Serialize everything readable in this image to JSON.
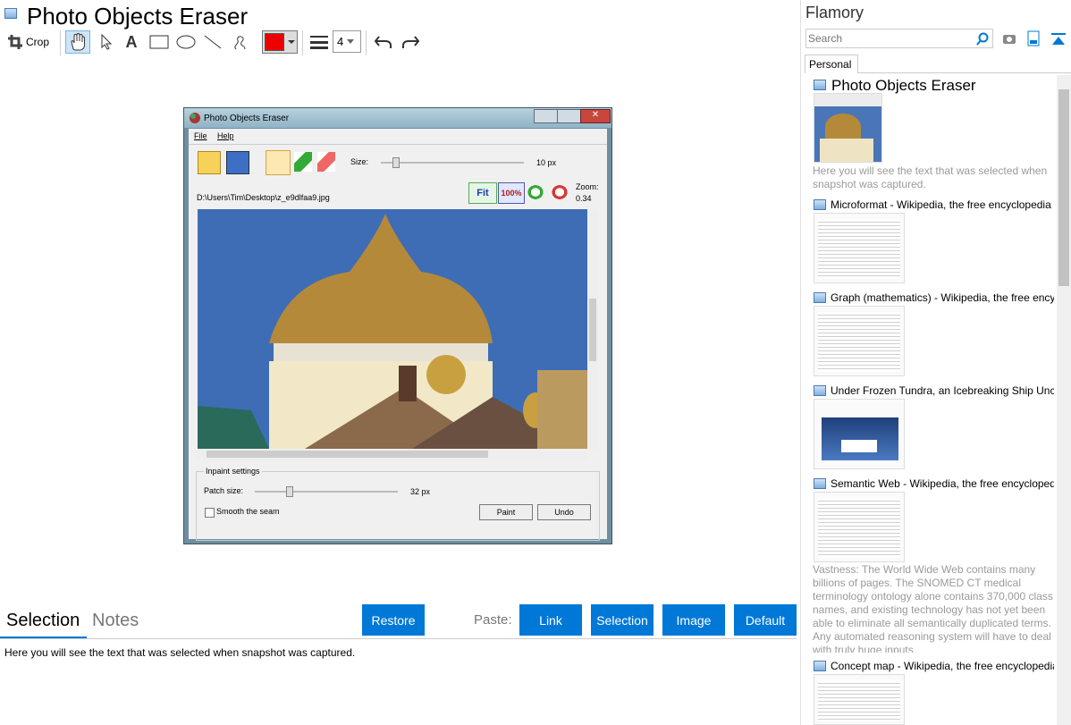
{
  "app": {
    "title": "Photo Objects Eraser"
  },
  "toolbar": {
    "crop_label": "Crop",
    "text_tool": "A",
    "line_width": "4",
    "color": "#ee0000"
  },
  "screenshot": {
    "window_title": "Photo Objects Eraser",
    "menu": [
      "File",
      "Help"
    ],
    "size_label": "Size:",
    "size_value": "10 px",
    "file_path": "D:\\Users\\Tim\\Desktop\\z_e9dlfaa9.jpg",
    "zoom_fit": "Fit",
    "zoom_100": "100%",
    "zoom_label": "Zoom:",
    "zoom_value": "0.34",
    "inpaint_group": "Inpaint settings",
    "patch_label": "Patch size:",
    "patch_value": "32 px",
    "smooth_label": "Smooth the seam",
    "paint_btn": "Paint",
    "undo_btn": "Undo"
  },
  "bottom": {
    "tabs": [
      "Selection",
      "Notes"
    ],
    "restore": "Restore",
    "paste_label": "Paste:",
    "paste_buttons": [
      "Link",
      "Selection",
      "Image",
      "Default"
    ],
    "selection_text": "Here you will see the text that was selected when snapshot was captured."
  },
  "sidebar": {
    "title": "Flamory",
    "search_placeholder": "Search",
    "tab": "Personal",
    "items": [
      {
        "title": "Photo Objects Eraser",
        "desc": "Here you will see the text that was selected when snapshot was captured."
      },
      {
        "title": "Microformat - Wikipedia, the free encyclopedia"
      },
      {
        "title": "Graph (mathematics) - Wikipedia, the free ency"
      },
      {
        "title": "Under Frozen Tundra, an Icebreaking Ship Unco"
      },
      {
        "title": "Semantic Web - Wikipedia, the free encycloped",
        "desc": "Vastness: The World Wide Web contains many billions of pages. The SNOMED CT medical terminology ontology alone contains 370,000 class names, and existing technology has not yet been able to eliminate all semantically duplicated terms. Any automated reasoning system will have to deal with truly huge inputs."
      },
      {
        "title": "Concept map - Wikipedia, the free encyclopedia"
      }
    ]
  },
  "colors": {
    "accent": "#0078d7",
    "gray_text": "#9a9a9a"
  }
}
